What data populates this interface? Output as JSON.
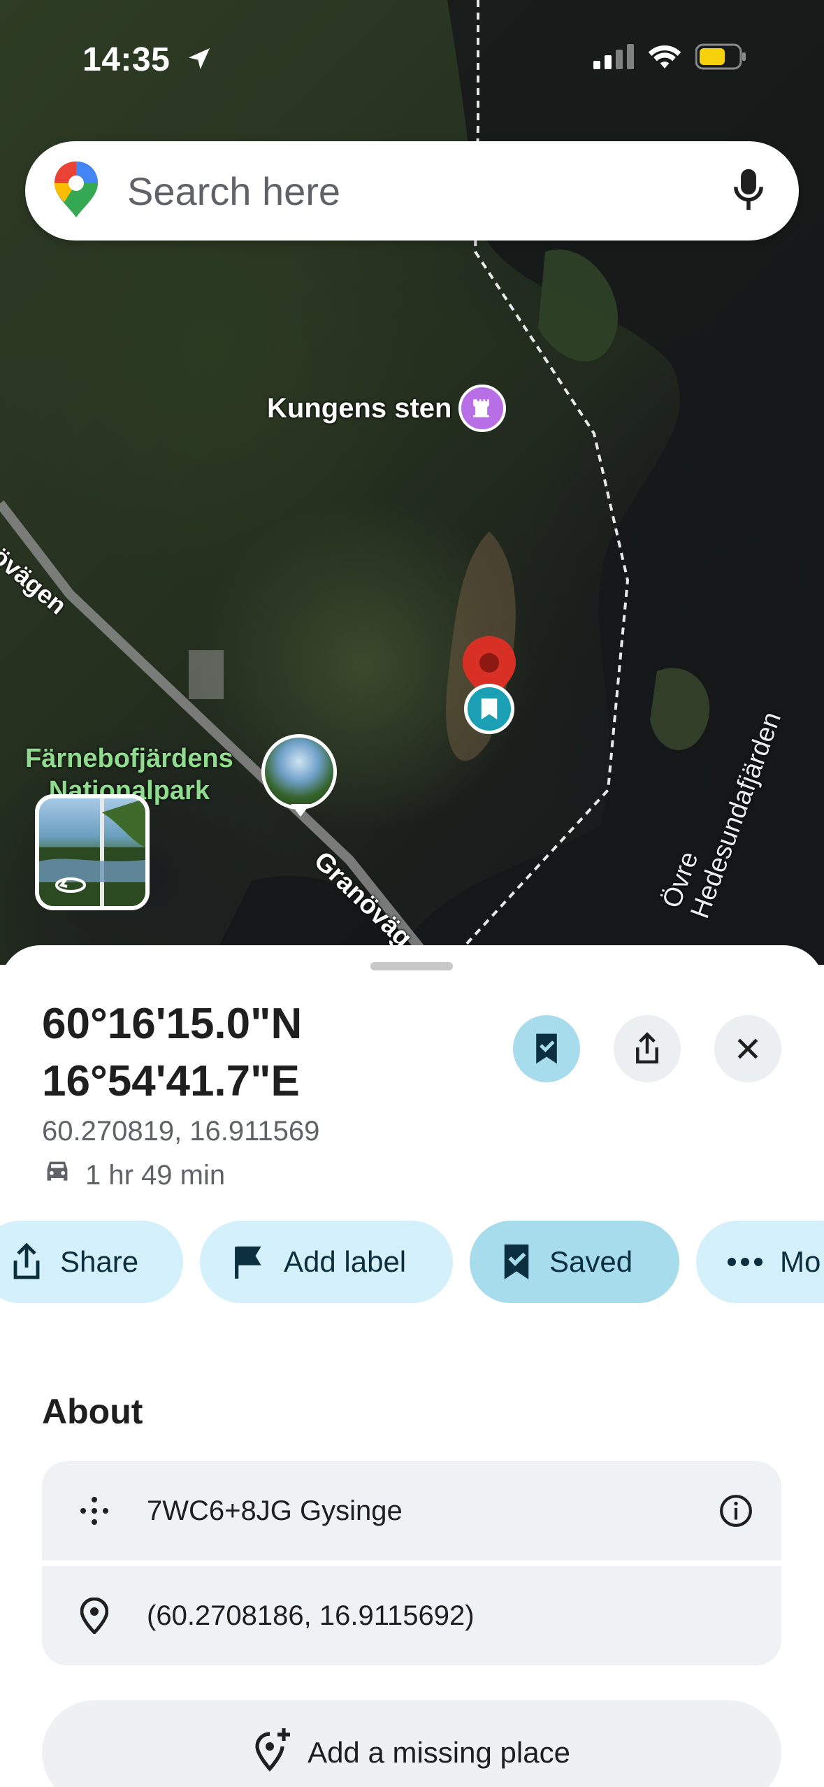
{
  "status_bar": {
    "time": "14:35"
  },
  "search": {
    "placeholder": "Search here"
  },
  "map": {
    "labels": {
      "poi": "Kungens sten",
      "road_upper": "növägen",
      "road_lower": "Granöväg",
      "lake": "Övre Hedesundafjärden",
      "park_line1": "Färnebofjärdens",
      "park_line2": "Nationalpark"
    }
  },
  "place": {
    "lat_dms": "60°16'15.0\"N",
    "lng_dms": "16°54'41.7\"E",
    "decimal": "60.270819, 16.911569",
    "drive_time": "1 hr 49 min"
  },
  "actions": {
    "share": "Share",
    "add_label": "Add label",
    "saved": "Saved",
    "more": "Mo"
  },
  "about": {
    "title": "About",
    "plus_code": "7WC6+8JG Gysinge",
    "coords": "(60.2708186, 16.9115692)",
    "add_missing_place": "Add a missing place"
  },
  "colors": {
    "accent_chip": "#d3f0fb",
    "saved_chip": "#a7dced",
    "pin_red": "#d93025",
    "park_green": "#8fdc8f"
  }
}
